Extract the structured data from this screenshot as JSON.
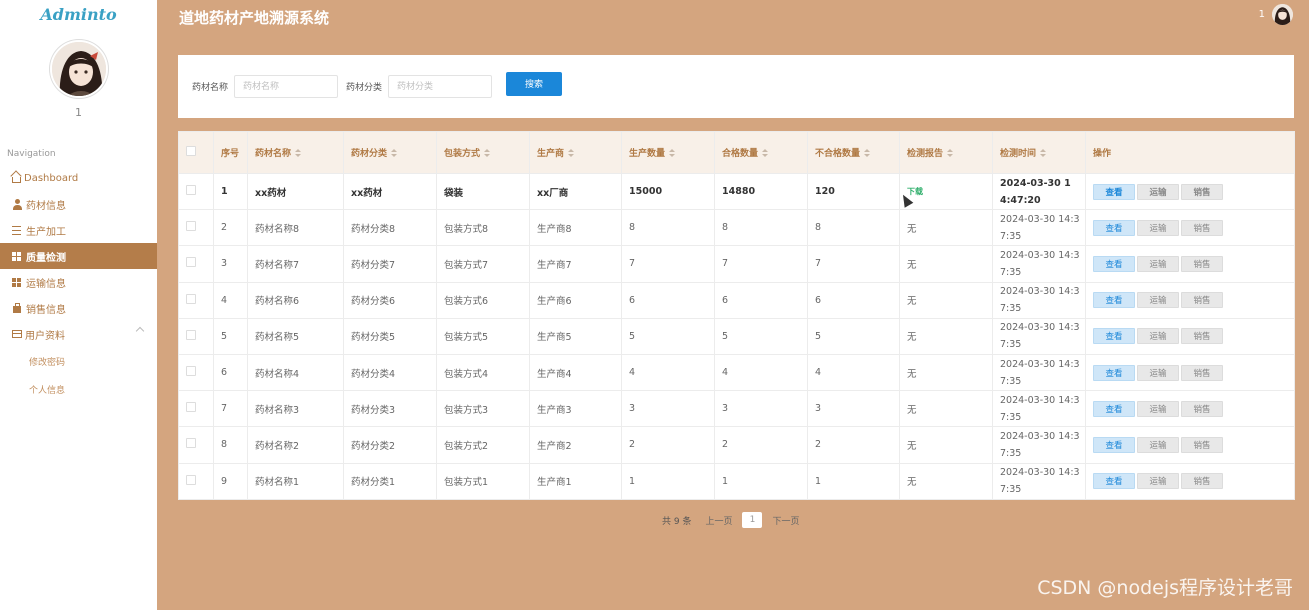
{
  "sidebar": {
    "brand": "Adminto",
    "username": "1",
    "nav_title": "Navigation",
    "items": [
      {
        "label": "Dashboard",
        "icon": "home-icon"
      },
      {
        "label": "药材信息",
        "icon": "user-icon"
      },
      {
        "label": "生产加工",
        "icon": "bars-icon"
      },
      {
        "label": "质量检测",
        "icon": "grid-icon"
      },
      {
        "label": "运输信息",
        "icon": "grid-icon"
      },
      {
        "label": "销售信息",
        "icon": "bag-icon"
      },
      {
        "label": "用户资料",
        "icon": "card-icon"
      }
    ],
    "sub_items": [
      "修改密码",
      "个人信息"
    ],
    "active_index": 3
  },
  "header": {
    "title": "道地药材产地溯源系统",
    "user": "1"
  },
  "search": {
    "name_label": "药材名称",
    "name_placeholder": "药材名称",
    "category_label": "药材分类",
    "category_placeholder": "药材分类",
    "button": "搜索"
  },
  "table": {
    "columns": [
      "序号",
      "药材名称",
      "药材分类",
      "包装方式",
      "生产商",
      "生产数量",
      "合格数量",
      "不合格数量",
      "检测报告",
      "检测时间",
      "操作"
    ],
    "rows": [
      {
        "no": "1",
        "name": "xx药材",
        "category": "xx药材",
        "pack": "袋装",
        "maker": "xx厂商",
        "qty": "15000",
        "pass": "14880",
        "fail": "120",
        "report": "下载",
        "time": "2024-03-30 14:47:20"
      },
      {
        "no": "2",
        "name": "药材名称8",
        "category": "药材分类8",
        "pack": "包装方式8",
        "maker": "生产商8",
        "qty": "8",
        "pass": "8",
        "fail": "8",
        "report": "无",
        "time": "2024-03-30 14:37:35"
      },
      {
        "no": "3",
        "name": "药材名称7",
        "category": "药材分类7",
        "pack": "包装方式7",
        "maker": "生产商7",
        "qty": "7",
        "pass": "7",
        "fail": "7",
        "report": "无",
        "time": "2024-03-30 14:37:35"
      },
      {
        "no": "4",
        "name": "药材名称6",
        "category": "药材分类6",
        "pack": "包装方式6",
        "maker": "生产商6",
        "qty": "6",
        "pass": "6",
        "fail": "6",
        "report": "无",
        "time": "2024-03-30 14:37:35"
      },
      {
        "no": "5",
        "name": "药材名称5",
        "category": "药材分类5",
        "pack": "包装方式5",
        "maker": "生产商5",
        "qty": "5",
        "pass": "5",
        "fail": "5",
        "report": "无",
        "time": "2024-03-30 14:37:35"
      },
      {
        "no": "6",
        "name": "药材名称4",
        "category": "药材分类4",
        "pack": "包装方式4",
        "maker": "生产商4",
        "qty": "4",
        "pass": "4",
        "fail": "4",
        "report": "无",
        "time": "2024-03-30 14:37:35"
      },
      {
        "no": "7",
        "name": "药材名称3",
        "category": "药材分类3",
        "pack": "包装方式3",
        "maker": "生产商3",
        "qty": "3",
        "pass": "3",
        "fail": "3",
        "report": "无",
        "time": "2024-03-30 14:37:35"
      },
      {
        "no": "8",
        "name": "药材名称2",
        "category": "药材分类2",
        "pack": "包装方式2",
        "maker": "生产商2",
        "qty": "2",
        "pass": "2",
        "fail": "2",
        "report": "无",
        "time": "2024-03-30 14:37:35"
      },
      {
        "no": "9",
        "name": "药材名称1",
        "category": "药材分类1",
        "pack": "包装方式1",
        "maker": "生产商1",
        "qty": "1",
        "pass": "1",
        "fail": "1",
        "report": "无",
        "time": "2024-03-30 14:37:35"
      }
    ],
    "actions": {
      "view": "查看",
      "transport": "运输",
      "sale": "销售"
    }
  },
  "pager": {
    "total": "共 9 条",
    "prev": "上一页",
    "page": "1",
    "next": "下一页"
  },
  "watermark": "CSDN @nodejs程序设计老哥",
  "colors": {
    "background": "#d4a57f",
    "active_nav": "#b47d4a",
    "primary": "#1b87d9",
    "header_text": "#b07a45"
  }
}
